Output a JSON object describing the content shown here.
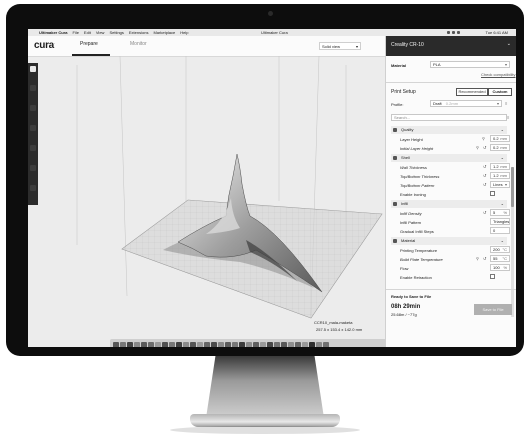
{
  "menubar": {
    "apple_glyph": "",
    "app_name": "Ultimaker Cura",
    "items": [
      "File",
      "Edit",
      "View",
      "Settings",
      "Extensions",
      "Marketplace",
      "Help"
    ],
    "window_title": "Ultimaker Cura",
    "clock": "Tue 6:41 AM"
  },
  "header": {
    "logo": "cura",
    "logo_mark": ".",
    "tabs": [
      {
        "label": "Prepare",
        "active": true
      },
      {
        "label": "Monitor",
        "active": false
      }
    ],
    "view_select": "Solid view"
  },
  "toolbar": {
    "tools": [
      "open-file-icon",
      "move-icon",
      "scale-icon",
      "rotate-icon",
      "mirror-icon",
      "per-model-settings-icon",
      "support-blocker-icon"
    ]
  },
  "viewport": {
    "object_name": "CCR10_mala-maketa",
    "object_dims": "257.5 x 153.4 x 142.0 mm"
  },
  "panel": {
    "printer": "Creality CR-10",
    "material_label": "Material",
    "material_value": "PLA",
    "check_compat": "Check compatibility",
    "print_setup": "Print Setup",
    "mode_recommended": "Recommended",
    "mode_custom": "Custom",
    "profile_label": "Profile:",
    "profile_value": "Draft",
    "profile_hint": "0.2mm",
    "search_placeholder": "Search...",
    "sections": {
      "quality": "Quality",
      "shell": "Shell",
      "infill": "Infill",
      "material": "Material"
    },
    "settings": {
      "layer_height": {
        "label": "Layer Height",
        "value": "0.2",
        "unit": "mm"
      },
      "initial_layer_height": {
        "label": "Initial Layer Height",
        "value": "0.2",
        "unit": "mm"
      },
      "wall_thickness": {
        "label": "Wall Thickness",
        "value": "1.2",
        "unit": "mm"
      },
      "top_bottom_thickness": {
        "label": "Top/Bottom Thickness",
        "value": "1.2",
        "unit": "mm"
      },
      "top_bottom_pattern": {
        "label": "Top/Bottom Pattern",
        "value": "Lines"
      },
      "enable_ironing": {
        "label": "Enable Ironing"
      },
      "infill_density": {
        "label": "Infill Density",
        "value": "5",
        "unit": "%"
      },
      "infill_pattern": {
        "label": "Infill Pattern",
        "value": "Triangles"
      },
      "gradual_infill": {
        "label": "Gradual Infill Steps",
        "value": "0"
      },
      "printing_temp": {
        "label": "Printing Temperature",
        "value": "200",
        "unit": "°C"
      },
      "build_plate_temp": {
        "label": "Build Plate Temperature",
        "value": "55",
        "unit": "°C"
      },
      "flow": {
        "label": "Flow",
        "value": "100",
        "unit": "%"
      },
      "enable_retraction": {
        "label": "Enable Retraction"
      }
    },
    "status": "Ready to Save to File",
    "print_time": "08h 29min",
    "print_material": "25.68m / ~77g",
    "save_button": "Save to File"
  },
  "colors": {
    "bezel": "#0d0d0d",
    "panel_header": "#2a2a2a",
    "toolbar": "#2c2c2c",
    "plate": "#d2d2d2"
  }
}
